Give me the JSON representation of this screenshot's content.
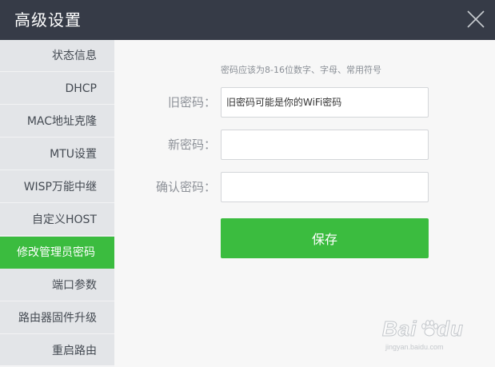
{
  "dialog": {
    "title": "高级设置",
    "close_icon": "close-icon"
  },
  "sidebar": {
    "items": [
      {
        "label": "状态信息",
        "active": false
      },
      {
        "label": "DHCP",
        "active": false
      },
      {
        "label": "MAC地址克隆",
        "active": false
      },
      {
        "label": "MTU设置",
        "active": false
      },
      {
        "label": "WISP万能中继",
        "active": false
      },
      {
        "label": "自定义HOST",
        "active": false
      },
      {
        "label": "修改管理员密码",
        "active": true
      },
      {
        "label": "端口参数",
        "active": false
      },
      {
        "label": "路由器固件升级",
        "active": false
      },
      {
        "label": "重启路由",
        "active": false
      }
    ]
  },
  "form": {
    "hint": "密码应该为8-16位数字、字母、常用符号",
    "old_password": {
      "label": "旧密码：",
      "placeholder": "旧密码可能是你的WiFi密码",
      "value": ""
    },
    "new_password": {
      "label": "新密码：",
      "value": ""
    },
    "confirm_password": {
      "label": "确认密码：",
      "value": ""
    },
    "save_label": "保存"
  },
  "watermark": {
    "url": "jingyan.baidu.com"
  },
  "colors": {
    "header_bg": "#363b47",
    "sidebar_bg": "#e3e5e8",
    "accent": "#3bbc3f",
    "content_bg": "#f7f7f7"
  }
}
